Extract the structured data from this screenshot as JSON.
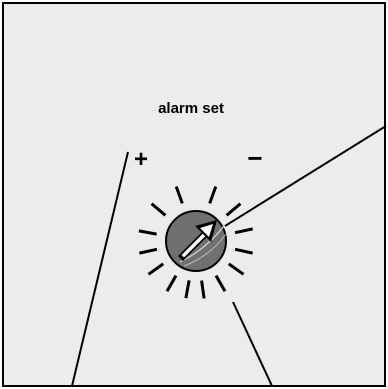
{
  "panel": {
    "title": "alarm set",
    "plus_label": "+",
    "minus_label": "−"
  },
  "colors": {
    "panel_fill": "#ececec",
    "outline": "#000000",
    "knob_fill": "#707070",
    "knob_highlight": "#d8d8d8",
    "arrow_fill": "#ffffff"
  },
  "icons": {
    "knob": "rotary-knob-icon",
    "arrow": "knob-pointer-arrow-icon"
  }
}
